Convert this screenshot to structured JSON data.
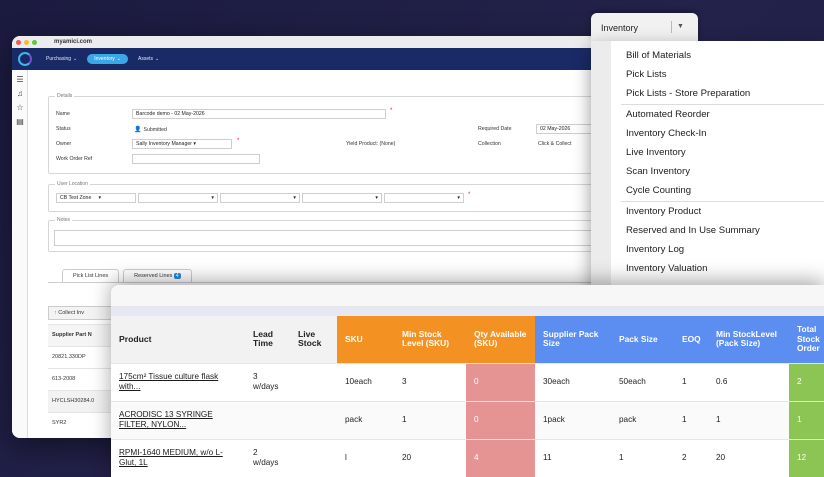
{
  "browser": {
    "url": "myamici.com"
  },
  "nav": {
    "items": [
      "Purchasing",
      "Inventory",
      "Assets"
    ]
  },
  "details": {
    "legend": "Details",
    "name_label": "Name",
    "name_value": "Barcode demo - 02 May-2026",
    "status_label": "Status",
    "status_value": "Submitted",
    "owner_label": "Owner",
    "owner_value": "Sally Inventory Manager",
    "work_order_label": "Work Order Ref",
    "required_date_label": "Required Date",
    "required_date_value": "02 May-2026",
    "yield_product": "Yield Product: (None)",
    "collection_label": "Collection",
    "collection_value": "Click & Collect"
  },
  "user_location": {
    "legend": "User Location",
    "zone": "CB Test Zone"
  },
  "notes": {
    "legend": "Notes"
  },
  "tabs": {
    "pick_list_lines": "Pick List Lines",
    "reserved_lines": "Reserved Lines",
    "reserved_count": "4"
  },
  "bg_table": {
    "collect_button": "Collect Inv",
    "header": "Supplier Part N",
    "rows": [
      "20821.330DP",
      "613-2008",
      "HYCLSH30284.0",
      "SYR2"
    ]
  },
  "dropdown": {
    "label": "Inventory",
    "items": [
      "Bill of Materials",
      "Pick Lists",
      "Pick Lists - Store Preparation",
      "Automated Reorder",
      "Inventory Check-In",
      "Live Inventory",
      "Scan Inventory",
      "Cycle Counting",
      "Inventory Product",
      "Reserved and In Use Summary",
      "Inventory Log",
      "Inventory Valuation"
    ]
  },
  "grid": {
    "headers": [
      "Product",
      "Lead Time",
      "Live Stock",
      "SKU",
      "Min Stock Level (SKU)",
      "Qty Available (SKU)",
      "Supplier Pack Size",
      "Pack Size",
      "EOQ",
      "Min StockLevel (Pack Size)",
      "Total Stock Order"
    ],
    "rows": [
      [
        "175cm² Tissue culture flask with...",
        "3 w/days",
        "",
        "10each",
        "3",
        "0",
        "30each",
        "50each",
        "1",
        "0.6",
        "2"
      ],
      [
        "ACRODISC 13 SYRINGE FILTER, NYLON...",
        "",
        "",
        "pack",
        "1",
        "0",
        "1pack",
        "pack",
        "1",
        "1",
        "1"
      ],
      [
        "RPMI-1640 MEDIUM, w/o L-Glut, 1L",
        "2 w/days",
        "",
        "l",
        "20",
        "4",
        "11",
        "1",
        "2",
        "20",
        "12"
      ]
    ]
  },
  "colors": {
    "orange": "#f39223",
    "blue": "#5b8ef0",
    "pink": "#e59393",
    "green": "#8dc554"
  }
}
